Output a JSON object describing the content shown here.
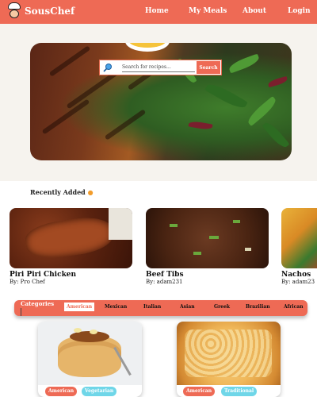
{
  "brand": {
    "name": "SousChef",
    "icon": "chef-hat-icon"
  },
  "nav": {
    "items": [
      "Home",
      "My Meals",
      "About",
      "Login"
    ]
  },
  "search": {
    "placeholder": "Search for recipes...",
    "button_label": "Search",
    "icon": "search-icon"
  },
  "recent": {
    "title": "Recently Added",
    "icon": "fire-icon",
    "cards": [
      {
        "name": "Piri Piri Chicken",
        "author": "By: Pro Chef"
      },
      {
        "name": "Beef Tibs",
        "author": "By: adam231"
      },
      {
        "name": "Nachos",
        "author": "By: adam23"
      }
    ]
  },
  "categories": {
    "title": "Categories",
    "items": [
      "American",
      "Mexican",
      "Italian",
      "Asian",
      "Greek",
      "Brazilian",
      "African"
    ],
    "active": "American"
  },
  "recipes": [
    {
      "tags": [
        "American",
        "Vegetarian"
      ]
    },
    {
      "tags": [
        "American",
        "Traditional"
      ]
    }
  ],
  "colors": {
    "accent": "#ee6a55",
    "tag_cyan": "#6fd6e8"
  }
}
